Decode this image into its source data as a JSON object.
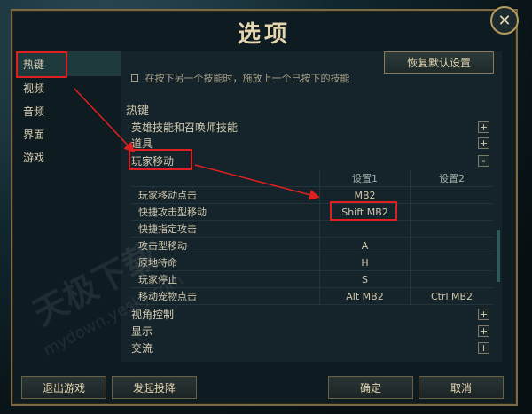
{
  "dialog": {
    "title": "选项",
    "close_glyph": "✕"
  },
  "sidebar": {
    "items": [
      {
        "label": "热键"
      },
      {
        "label": "视频"
      },
      {
        "label": "音频"
      },
      {
        "label": "界面"
      },
      {
        "label": "游戏"
      }
    ]
  },
  "panel": {
    "restore_label": "恢复默认设置",
    "cut_text": "在按下另一个技能时，施放上一个已按下的技能",
    "section_title": "热键",
    "groups_top": [
      {
        "label": "英雄技能和召唤师技能",
        "toggle": "+"
      },
      {
        "label": "道具",
        "toggle": "+"
      },
      {
        "label": "玩家移动",
        "toggle": "-"
      }
    ],
    "table": {
      "headers": [
        "",
        "设置1",
        "设置2"
      ],
      "rows": [
        [
          "玩家移动点击",
          "MB2",
          ""
        ],
        [
          "快捷攻击型移动",
          "Shift MB2",
          ""
        ],
        [
          "快捷指定攻击",
          "",
          ""
        ],
        [
          "攻击型移动",
          "A",
          ""
        ],
        [
          "原地待命",
          "H",
          ""
        ],
        [
          "玩家停止",
          "S",
          ""
        ],
        [
          "移动宠物点击",
          "Alt MB2",
          "Ctrl MB2"
        ]
      ]
    },
    "groups_bottom": [
      {
        "label": "视角控制",
        "toggle": "+"
      },
      {
        "label": "显示",
        "toggle": "+"
      },
      {
        "label": "交流",
        "toggle": "+"
      }
    ]
  },
  "footer": {
    "exit_label": "退出游戏",
    "surrender_label": "发起投降",
    "ok_label": "确定",
    "cancel_label": "取消"
  },
  "watermark": {
    "line1": "天极下载",
    "line2": "mydown.yesky.com"
  },
  "colors": {
    "highlight": "#e02020",
    "gold_border": "#7a6a45"
  }
}
